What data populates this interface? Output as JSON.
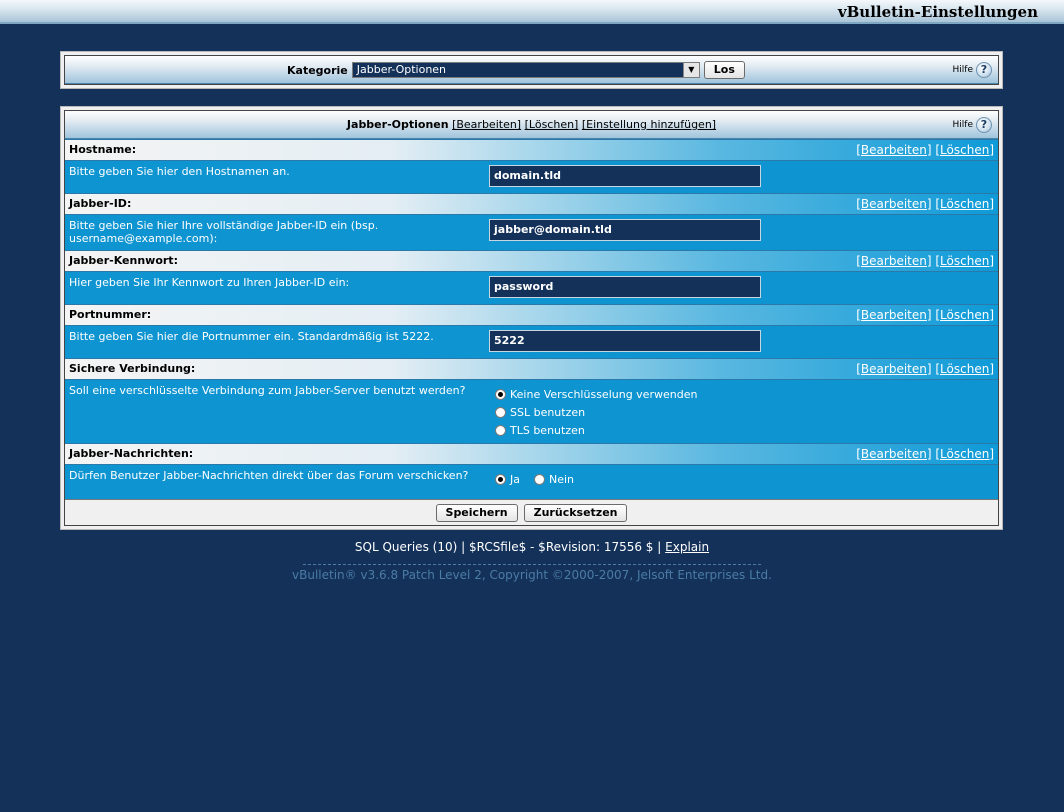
{
  "window": {
    "title": "vBulletin-Einstellungen"
  },
  "category_panel": {
    "label": "Kategorie",
    "selected": "Jabber-Optionen",
    "go_button": "Los",
    "help": "Hilfe",
    "help_icon": "?"
  },
  "options_panel": {
    "title": "Jabber-Optionen",
    "edit": "[Bearbeiten]",
    "delete": "[Löschen]",
    "add_setting": "[Einstellung hinzufügen]",
    "help": "Hilfe",
    "help_icon": "?"
  },
  "settings": [
    {
      "name": "Hostname:",
      "desc": "Bitte geben Sie hier den Hostnamen an.",
      "value": "domain.tld",
      "edit": "[Bearbeiten]",
      "delete": "[Löschen]"
    },
    {
      "name": "Jabber-ID:",
      "desc": "Bitte geben Sie hier Ihre vollständige Jabber-ID ein (bsp. username@example.com):",
      "value": "jabber@domain.tld",
      "edit": "[Bearbeiten]",
      "delete": "[Löschen]"
    },
    {
      "name": "Jabber-Kennwort:",
      "desc": "Hier geben Sie Ihr Kennwort zu Ihren Jabber-ID ein:",
      "value": "password",
      "edit": "[Bearbeiten]",
      "delete": "[Löschen]"
    },
    {
      "name": "Portnummer:",
      "desc": "Bitte geben Sie hier die Portnummer ein. Standardmäßig ist 5222.",
      "value": "5222",
      "edit": "[Bearbeiten]",
      "delete": "[Löschen]"
    },
    {
      "name": "Sichere Verbindung:",
      "desc": "Soll eine verschlüsselte Verbindung zum Jabber-Server benutzt werden?",
      "options": [
        "Keine Verschlüsselung verwenden",
        "SSL benutzen",
        "TLS benutzen"
      ],
      "selected": "Keine Verschlüsselung verwenden",
      "edit": "[Bearbeiten]",
      "delete": "[Löschen]"
    },
    {
      "name": "Jabber-Nachrichten:",
      "desc": "Dürfen Benutzer Jabber-Nachrichten direkt über das Forum verschicken?",
      "options": [
        "Ja",
        "Nein"
      ],
      "selected": "Ja",
      "edit": "[Bearbeiten]",
      "delete": "[Löschen]"
    }
  ],
  "buttons": {
    "save": "Speichern",
    "reset": "Zurücksetzen"
  },
  "footer": {
    "queries": "SQL Queries (10) | $RCSfile$ - $Revision: 17556 $ |",
    "explain": "Explain",
    "copyright": "vBulletin® v3.6.8 Patch Level 2, Copyright ©2000-2007, Jelsoft Enterprises Ltd."
  }
}
